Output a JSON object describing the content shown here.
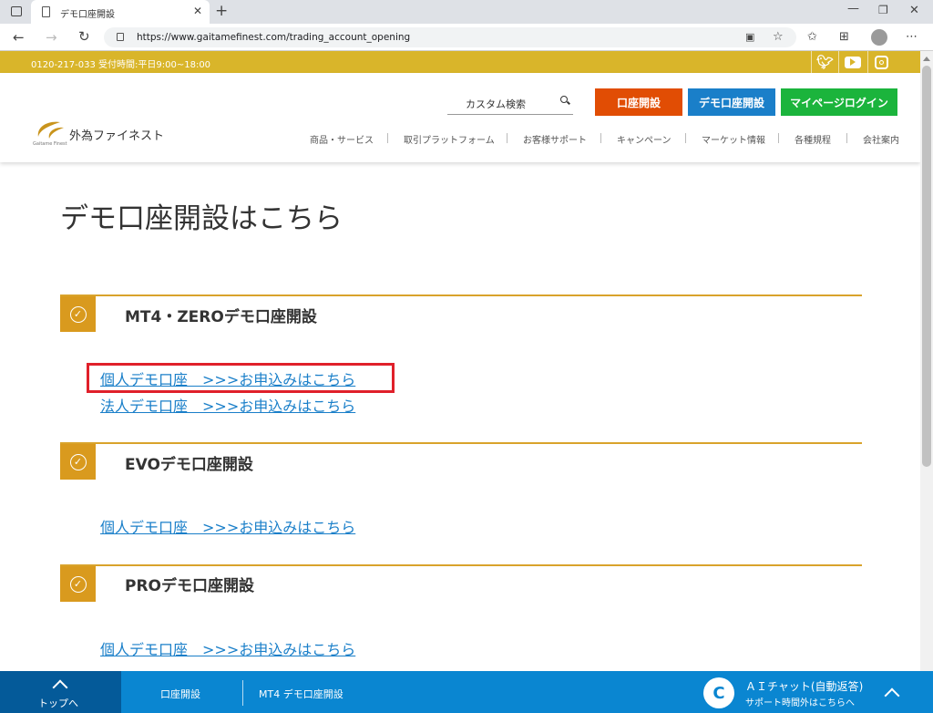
{
  "browser": {
    "tab_title": "デモ口座開設",
    "url": "https://www.gaitamefinest.com/trading_account_opening"
  },
  "topstrip": {
    "contact": "0120-217-033 受付時間:平日9:00~18:00",
    "social": [
      "twitter-icon",
      "youtube-icon",
      "instagram-icon"
    ]
  },
  "header": {
    "logo_text": "外為ファイネスト",
    "logo_sub": "Gaitame Finest",
    "search_label": "カスタム検索",
    "buttons": [
      {
        "label": "口座開設",
        "color": "#e14d04"
      },
      {
        "label": "デモ口座開設",
        "color": "#1a7fc9"
      },
      {
        "label": "マイページログイン",
        "color": "#1bb43c"
      }
    ],
    "nav": [
      "商品・サービス",
      "取引プラットフォーム",
      "お客様サポート",
      "キャンペーン",
      "マーケット情報",
      "各種規程",
      "会社案内"
    ]
  },
  "main": {
    "page_title": "デモ口座開設はこちら",
    "sections": [
      {
        "title": "MT4・ZEROデモ口座開設",
        "links": [
          "個人デモ口座　>>>お申込みはこちら",
          "法人デモ口座　>>>お申込みはこちら"
        ]
      },
      {
        "title": "EVOデモ口座開設",
        "links": [
          "個人デモ口座　>>>お申込みはこちら"
        ]
      },
      {
        "title": "PROデモ口座開設",
        "links": [
          "個人デモ口座　>>>お申込みはこちら"
        ]
      }
    ]
  },
  "bottombar": {
    "top_label": "トップへ",
    "items": [
      "口座開設",
      "MT4 デモ口座開設"
    ],
    "chat_title": "ＡＩチャット(自動返答)",
    "chat_sub": "サポート時間外はこちらへ"
  },
  "colors": {
    "accent": "#d9b52a",
    "section": "#d99a1e",
    "link": "#1a7fc9",
    "highlight": "#e0202a",
    "bottombar": "#0a86d1"
  }
}
